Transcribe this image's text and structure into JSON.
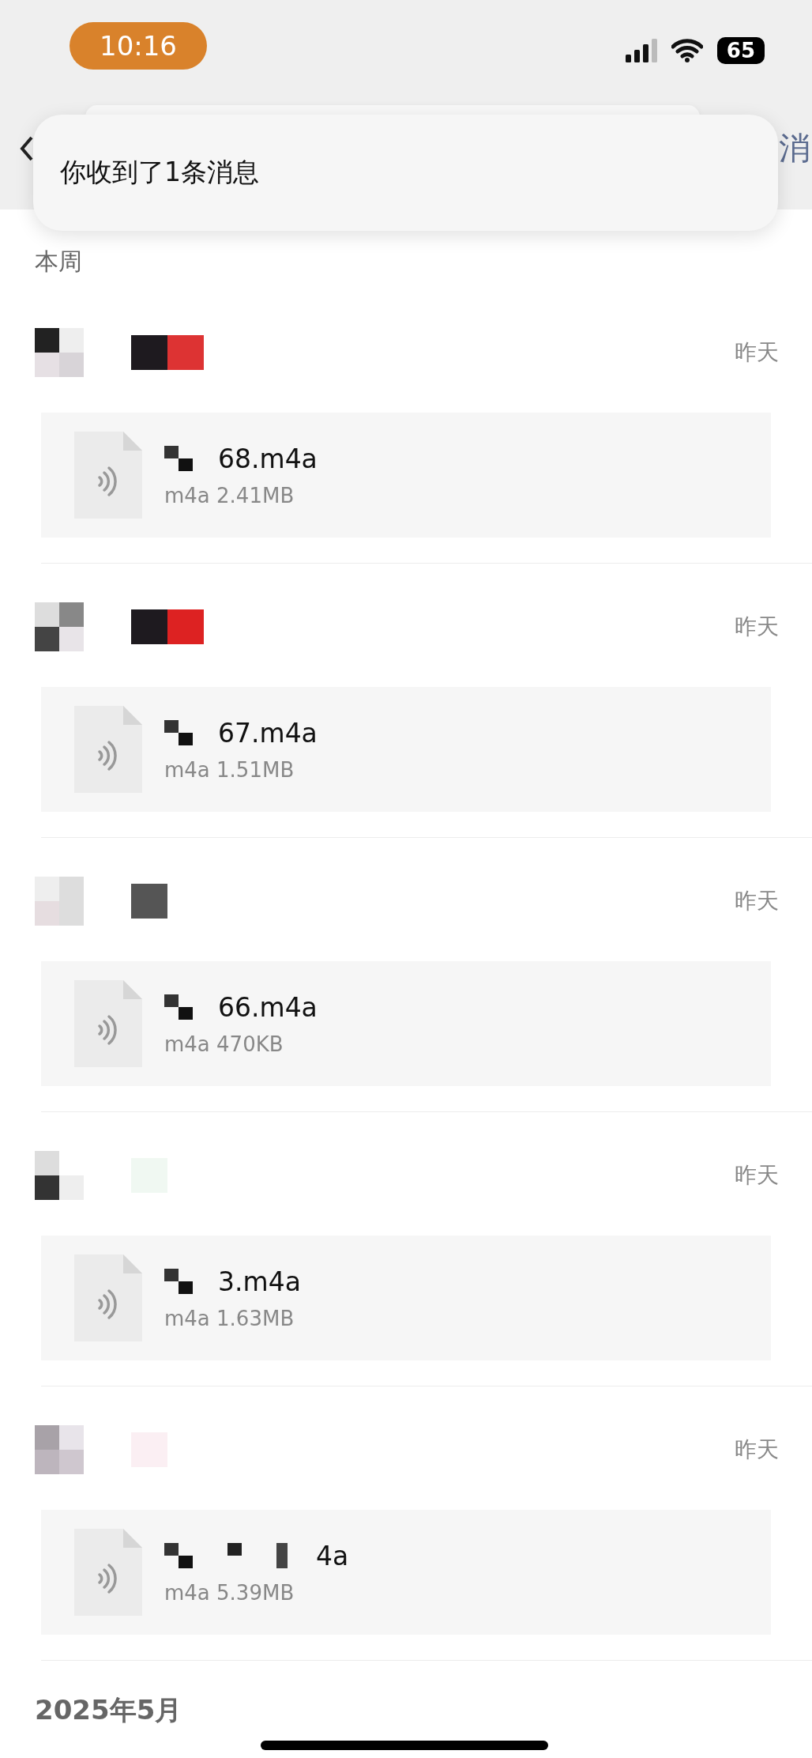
{
  "status_bar": {
    "time": "10:16",
    "battery": "65"
  },
  "nav": {
    "action": "消"
  },
  "notification": {
    "text": "你收到了1条消息"
  },
  "sections": [
    {
      "title": "本周",
      "items": [
        {
          "date": "昨天",
          "file_name": "68.m4a",
          "file_meta": "m4a 2.41MB"
        },
        {
          "date": "昨天",
          "file_name": "67.m4a",
          "file_meta": "m4a 1.51MB"
        },
        {
          "date": "昨天",
          "file_name": "66.m4a",
          "file_meta": "m4a 470KB"
        },
        {
          "date": "昨天",
          "file_name": "3.m4a",
          "file_meta": "m4a 1.63MB"
        },
        {
          "date": "昨天",
          "file_name": "4a",
          "file_meta": "m4a 5.39MB"
        }
      ]
    },
    {
      "title": "2025年5月"
    }
  ]
}
